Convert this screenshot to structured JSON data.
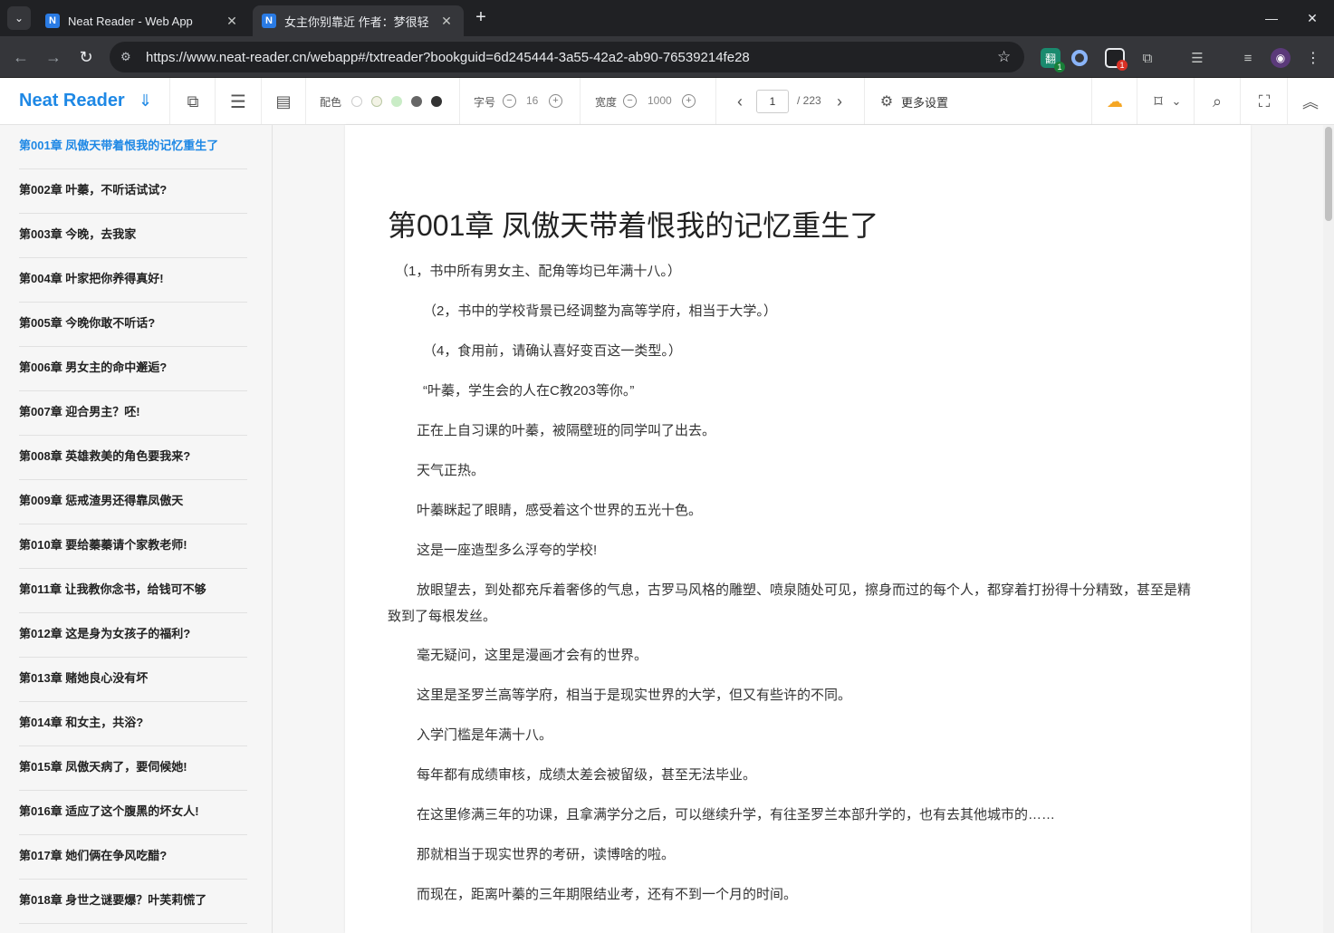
{
  "browser": {
    "tabs": [
      {
        "favicon": "N",
        "title": "Neat Reader - Web App",
        "close": "✕"
      },
      {
        "favicon": "N",
        "title": "女主你别靠近 作者：梦很轻",
        "close": "✕"
      }
    ],
    "new_tab": "+",
    "url": "https://www.neat-reader.cn/webapp#/txtreader?bookguid=6d245444-3a55-42a2-ab90-76539214fe28",
    "window_controls": [
      "—",
      "☐",
      "✕"
    ],
    "extension_badges": [
      "1",
      "1"
    ]
  },
  "app": {
    "brand": "Neat Reader",
    "color_label": "配色",
    "font_label": "字号",
    "font_size": "16",
    "width_label": "宽度",
    "width_value": "1000",
    "current_page": "1",
    "total_pages": "/ 223",
    "more_settings": "更多设置",
    "swatches": [
      "#ffffff",
      "#f3f3e6",
      "#c9ecc6",
      "#666666",
      "#333333"
    ],
    "accent": "#1e88e5"
  },
  "sidebar": {
    "chapters": [
      "第001章 凤傲天带着恨我的记忆重生了",
      "第002章 叶蓁，不听话试试?",
      "第003章 今晚，去我家",
      "第004章 叶家把你养得真好!",
      "第005章 今晚你敢不听话?",
      "第006章 男女主的命中邂逅?",
      "第007章 迎合男主？呸!",
      "第008章 英雄救美的角色要我来?",
      "第009章 惩戒渣男还得靠凤傲天",
      "第010章 要给蓁蓁请个家教老师!",
      "第011章 让我教你念书，给钱可不够",
      "第012章 这是身为女孩子的福利?",
      "第013章 赌她良心没有坏",
      "第014章 和女主，共浴?",
      "第015章 凤傲天病了，要伺候她!",
      "第016章 适应了这个腹黑的坏女人!",
      "第017章 她们俩在争风吃醋?",
      "第018章 身世之谜要爆？叶芙莉慌了"
    ]
  },
  "content": {
    "title": "第001章 凤傲天带着恨我的记忆重生了",
    "paragraphs": [
      "（1，书中所有男女主、配角等均已年满十八。）",
      "（2，书中的学校背景已经调整为高等学府，相当于大学。）",
      "（4，食用前，请确认喜好变百这一类型。）",
      "“叶蓁，学生会的人在C教203等你。”",
      "正在上自习课的叶蓁，被隔壁班的同学叫了出去。",
      "天气正热。",
      "叶蓁眯起了眼睛，感受着这个世界的五光十色。",
      "这是一座造型多么浮夸的学校!",
      "放眼望去，到处都充斥着奢侈的气息，古罗马风格的雕塑、喷泉随处可见，擦身而过的每个人，都穿着打扮得十分精致，甚至是精致到了每根发丝。",
      "毫无疑问，这里是漫画才会有的世界。",
      "这里是圣罗兰高等学府，相当于是现实世界的大学，但又有些许的不同。",
      "入学门槛是年满十八。",
      "每年都有成绩审核，成绩太差会被留级，甚至无法毕业。",
      "在这里修满三年的功课，且拿满学分之后，可以继续升学，有往圣罗兰本部升学的，也有去其他城市的……",
      "那就相当于现实世界的考研，读博啥的啦。",
      "而现在，距离叶蓁的三年期限结业考，还有不到一个月的时间。"
    ]
  }
}
